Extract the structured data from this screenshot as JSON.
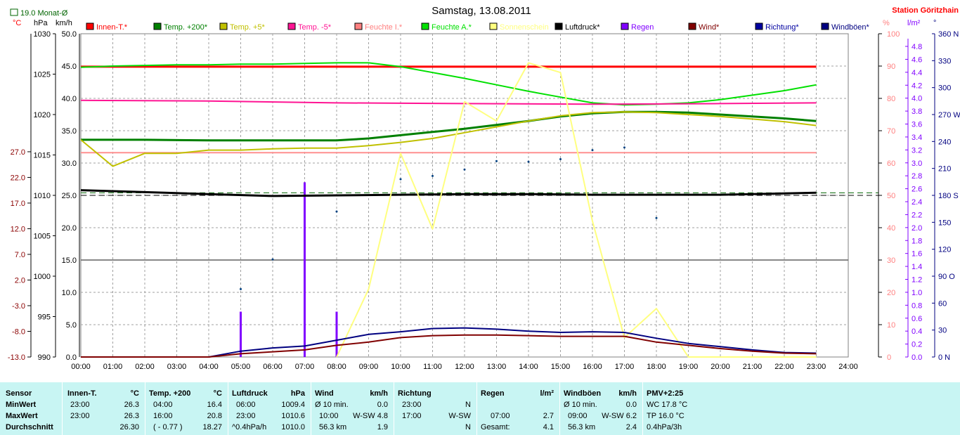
{
  "header": {
    "title": "Samstag, 13.08.2011",
    "station": "Station Göritzhain",
    "monthly_avg_label": "19.0 Monat-Ø"
  },
  "units": {
    "temp": "°C",
    "pressure": "hPa",
    "speed": "km/h",
    "humidity": "%",
    "rain": "l/m²",
    "degree": "°"
  },
  "legend": [
    {
      "label": "Innen-T.*",
      "color": "#ff0000",
      "faded": false
    },
    {
      "label": "Temp. +200*",
      "color": "#008000",
      "faded": false
    },
    {
      "label": "Temp. +5*",
      "color": "#c0c000",
      "faded": false
    },
    {
      "label": "Temp. -5*",
      "color": "#ff1493",
      "faded": false
    },
    {
      "label": "Feuchte I.*",
      "color": "#ff8080",
      "faded": true
    },
    {
      "label": "Feuchte A.*",
      "color": "#00e000",
      "faded": true
    },
    {
      "label": "Sonnenschein",
      "color": "#ffff80",
      "faded": true
    },
    {
      "label": "Luftdruck*",
      "color": "#000000",
      "faded": false
    },
    {
      "label": "Regen",
      "color": "#8000ff",
      "faded": false
    },
    {
      "label": "Wind*",
      "color": "#800000",
      "faded": false
    },
    {
      "label": "Richtung*",
      "color": "#0000a0",
      "faded": false
    },
    {
      "label": "Windböen*",
      "color": "#000080",
      "faded": false
    }
  ],
  "chart_data": {
    "type": "line",
    "x_ticks": [
      "00:00",
      "01:00",
      "02:00",
      "03:00",
      "04:00",
      "05:00",
      "06:00",
      "07:00",
      "08:00",
      "09:00",
      "10:00",
      "11:00",
      "12:00",
      "13:00",
      "14:00",
      "15:00",
      "16:00",
      "17:00",
      "18:00",
      "19:00",
      "20:00",
      "21:00",
      "22:00",
      "23:00",
      "24:00"
    ],
    "axes": {
      "temp_c": {
        "range": [
          -13,
          50
        ],
        "ticks": [
          "27.0",
          "22.0",
          "17.0",
          "12.0",
          "7.0",
          "2.0",
          "-3.0",
          "-8.0",
          "-13.0"
        ],
        "tick_values": [
          27,
          22,
          17,
          12,
          7,
          2,
          -3,
          -8,
          -13
        ]
      },
      "pressure_hpa": {
        "range": [
          990,
          1030
        ],
        "ticks": [
          "1030",
          "1025",
          "1020",
          "1015",
          "1010",
          "1005",
          "1000",
          "995",
          "990"
        ]
      },
      "speed_kmh": {
        "range": [
          0,
          50
        ],
        "ticks": [
          "50.0",
          "45.0",
          "40.0",
          "35.0",
          "30.0",
          "25.0",
          "20.0",
          "15.0",
          "10.0",
          "5.0",
          "0.0"
        ]
      },
      "humidity_pct": {
        "range": [
          0,
          100
        ],
        "ticks": [
          "100",
          "90",
          "80",
          "70",
          "60",
          "50",
          "40",
          "30",
          "20",
          "10",
          "0"
        ]
      },
      "rain_lm2": {
        "range": [
          0,
          4.8
        ],
        "ticks": [
          "4.8",
          "4.6",
          "4.4",
          "4.2",
          "4.0",
          "3.8",
          "3.6",
          "3.4",
          "3.2",
          "3.0",
          "2.8",
          "2.6",
          "2.4",
          "2.2",
          "2.0",
          "1.8",
          "1.6",
          "1.4",
          "1.2",
          "1.0",
          "0.8",
          "0.6",
          "0.4",
          "0.2",
          "0.0"
        ]
      },
      "direction_deg": {
        "range": [
          0,
          360
        ],
        "ticks": [
          "360 N",
          "330",
          "300",
          "270 W",
          "240",
          "210",
          "180 S",
          "150",
          "120",
          "90 O",
          "60",
          "30",
          "0 N"
        ],
        "tick_values": [
          360,
          330,
          300,
          270,
          240,
          210,
          180,
          150,
          120,
          90,
          60,
          30,
          0
        ]
      }
    },
    "reference_lines": [
      {
        "name": "Monat-Ø",
        "value": 19.0,
        "axis": "temp_c",
        "style": "dashed",
        "color": "#006400"
      },
      {
        "name": "Luftdruck-ref",
        "value": 1010,
        "axis": "pressure_hpa",
        "style": "dashed",
        "color": "#000000"
      }
    ],
    "series": [
      {
        "name": "Innen-T.",
        "axis": "speed_kmh",
        "color": "#ff0000",
        "width": 3,
        "x": [
          0,
          23
        ],
        "y": [
          44.9,
          44.9
        ]
      },
      {
        "name": "Feuchte A.",
        "axis": "speed_kmh",
        "color": "#00e000",
        "width": 2,
        "x": [
          0,
          1,
          2,
          3,
          4,
          5,
          6,
          7,
          8,
          9,
          10,
          11,
          12,
          13,
          14,
          15,
          16,
          17,
          18,
          19,
          20,
          21,
          22,
          23
        ],
        "y": [
          44.8,
          45.0,
          45.1,
          45.2,
          45.2,
          45.3,
          45.3,
          45.4,
          45.5,
          45.5,
          44.9,
          44.0,
          43.1,
          42.1,
          41.1,
          40.2,
          39.3,
          39.0,
          39.1,
          39.3,
          39.8,
          40.5,
          41.2,
          42.1
        ]
      },
      {
        "name": "Temp. -5",
        "axis": "speed_kmh",
        "color": "#ff1493",
        "width": 2,
        "x": [
          0,
          4,
          8,
          12,
          16,
          20,
          23
        ],
        "y": [
          39.7,
          39.6,
          39.3,
          39.2,
          39.1,
          39.2,
          39.3
        ]
      },
      {
        "name": "Feuchte I.",
        "axis": "speed_kmh",
        "color": "#ff9090",
        "width": 2,
        "x": [
          0,
          23
        ],
        "y": [
          31.6,
          31.6
        ]
      },
      {
        "name": "Temp. +200",
        "axis": "speed_kmh",
        "color": "#008000",
        "width": 3,
        "x": [
          0,
          2,
          4,
          6,
          8,
          9,
          10,
          11,
          12,
          13,
          14,
          15,
          16,
          17,
          18,
          19,
          20,
          21,
          22,
          23
        ],
        "y": [
          33.6,
          33.6,
          33.5,
          33.5,
          33.5,
          33.8,
          34.3,
          34.8,
          35.3,
          35.9,
          36.5,
          37.2,
          37.7,
          37.9,
          37.9,
          37.8,
          37.5,
          37.2,
          36.9,
          36.5
        ]
      },
      {
        "name": "Temp. +5",
        "axis": "speed_kmh",
        "color": "#c0c000",
        "width": 2,
        "x": [
          0,
          1,
          2,
          3,
          4,
          5,
          6,
          7,
          8,
          9,
          10,
          11,
          12,
          13,
          14,
          15,
          16,
          17,
          18,
          19,
          20,
          21,
          22,
          23
        ],
        "y": [
          33.6,
          29.5,
          31.5,
          31.5,
          32.0,
          32.0,
          32.2,
          32.3,
          32.3,
          32.7,
          33.2,
          33.8,
          34.7,
          35.6,
          36.5,
          37.3,
          37.8,
          37.9,
          37.8,
          37.5,
          37.2,
          36.8,
          36.4,
          35.8
        ]
      },
      {
        "name": "Luftdruck",
        "axis": "speed_kmh",
        "color": "#000000",
        "width": 3,
        "x": [
          0,
          2,
          4,
          6,
          8,
          10,
          12,
          14,
          16,
          18,
          20,
          22,
          23
        ],
        "y": [
          25.8,
          25.5,
          25.2,
          24.9,
          25.0,
          25.1,
          25.2,
          25.2,
          25.1,
          25.1,
          25.1,
          25.3,
          25.4
        ]
      },
      {
        "name": "Sonnenschein",
        "axis": "speed_kmh",
        "color": "#ffff80",
        "width": 2,
        "x": [
          8,
          9,
          10,
          11,
          12,
          13,
          14,
          15,
          16,
          17,
          18,
          19,
          20,
          21,
          22,
          23
        ],
        "y": [
          0,
          10.5,
          31.5,
          19.8,
          39.5,
          36.5,
          45.5,
          44.0,
          21.0,
          3.0,
          7.5,
          0,
          0,
          0,
          0,
          0
        ]
      },
      {
        "name": "Windböen",
        "axis": "speed_kmh",
        "color": "#000080",
        "width": 2,
        "x": [
          0,
          4,
          5,
          6,
          7,
          8,
          9,
          10,
          11,
          12,
          13,
          14,
          15,
          16,
          17,
          18,
          19,
          20,
          21,
          22,
          23
        ],
        "y": [
          0,
          0,
          0.9,
          1.4,
          1.7,
          2.6,
          3.5,
          3.9,
          4.4,
          4.5,
          4.3,
          4.0,
          3.8,
          3.9,
          3.8,
          2.9,
          2.1,
          1.6,
          1.1,
          0.7,
          0.6
        ]
      },
      {
        "name": "Wind",
        "axis": "speed_kmh",
        "color": "#800000",
        "width": 2,
        "x": [
          0,
          4,
          5,
          6,
          7,
          8,
          9,
          10,
          11,
          12,
          13,
          14,
          15,
          16,
          17,
          18,
          19,
          20,
          21,
          22,
          23
        ],
        "y": [
          0,
          0,
          0.5,
          0.8,
          1.1,
          1.8,
          2.3,
          3.0,
          3.3,
          3.4,
          3.4,
          3.3,
          3.2,
          3.2,
          3.2,
          2.3,
          1.8,
          1.3,
          0.9,
          0.6,
          0.5
        ]
      },
      {
        "name": "Richtung",
        "axis": "speed_kmh",
        "type": "scatter",
        "color": "#004080",
        "x": [
          5,
          6,
          8,
          10,
          11,
          12,
          13,
          14,
          15,
          16,
          17,
          18
        ],
        "y": [
          10.5,
          15.1,
          22.5,
          27.5,
          28.0,
          29.0,
          30.3,
          30.2,
          30.6,
          32.0,
          32.4,
          21.5
        ]
      },
      {
        "name": "Regen",
        "axis": "rain_lm2",
        "type": "bar",
        "color": "#8000ff",
        "x": [
          5,
          7,
          8
        ],
        "y": [
          0.7,
          2.7,
          0.7
        ]
      }
    ]
  },
  "stats": {
    "sensor": {
      "header": "Sensor",
      "rows": [
        "MinWert",
        "MaxWert",
        "Durchschnitt"
      ]
    },
    "innen": {
      "header": "Innen-T.",
      "unit": "°C",
      "r1a": "23:00",
      "r1b": "26.3",
      "r2a": "23:00",
      "r2b": "26.3",
      "r3a": "",
      "r3b": "26.30"
    },
    "temp200": {
      "header": "Temp. +200",
      "unit": "°C",
      "r1a": "04:00",
      "r1b": "16.4",
      "r2a": "16:00",
      "r2b": "20.8",
      "r3a": "( - 0.77 )",
      "r3b": "18.27"
    },
    "luftdruck": {
      "header": "Luftdruck",
      "unit": "hPa",
      "r1a": "06:00",
      "r1b": "1009.4",
      "r2a": "23:00",
      "r2b": "1010.6",
      "r3a": "^0.4hPa/h",
      "r3b": "1010.0"
    },
    "wind": {
      "header": "Wind",
      "unit": "km/h",
      "r1a": "Ø 10 min.",
      "r1b": "0.0",
      "r2a": "10:00",
      "r2m": "W-SW 4.8",
      "r3a": "56.3 km",
      "r3b": "1.9"
    },
    "richtung": {
      "header": "Richtung",
      "r1a": "23:00",
      "r1b": "N",
      "r2a": "17:00",
      "r2b": "W-SW",
      "r3b": "N"
    },
    "regen": {
      "header": "Regen",
      "unit": "l/m²",
      "r2a": "07:00",
      "r2b": "2.7",
      "r3a": "Gesamt:",
      "r3b": "4.1"
    },
    "boeen": {
      "header": "Windböen",
      "unit": "km/h",
      "r1a": "Ø 10 min.",
      "r1b": "0.0",
      "r2a": "09:00",
      "r2m": "W-SW 6.2",
      "r3a": "56.3 km",
      "r3b": "2.4"
    },
    "pmv": {
      "header": "PMV+2:25",
      "r1": "WC 17.8 °C",
      "r2": "TP 16.0 °C",
      "r3": "0.4hPa/3h"
    }
  }
}
